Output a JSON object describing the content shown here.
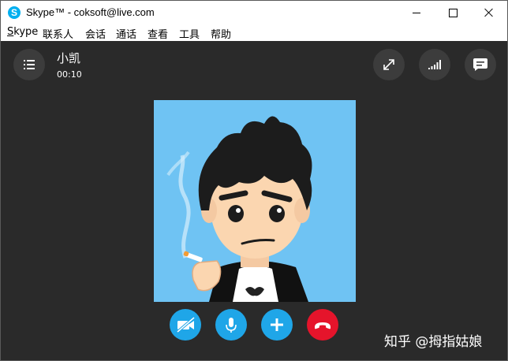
{
  "window": {
    "title": "Skype™ - coksoft@live.com",
    "logo_letter": "S"
  },
  "menu": {
    "items": [
      "Skype",
      "联系人",
      "会话",
      "通话",
      "查看",
      "工具",
      "帮助"
    ]
  },
  "call": {
    "contact_name": "小凯",
    "timer": "00:10"
  },
  "icons": {
    "menu": "list-menu-icon",
    "fullscreen": "expand-icon",
    "quality": "signal-bars-icon",
    "chat": "chat-bubble-icon",
    "video": "video-off-icon",
    "mic": "microphone-icon",
    "add": "plus-icon",
    "hangup": "end-call-icon"
  },
  "colors": {
    "call_background": "#2a2a2a",
    "control_blue": "#1fa6e8",
    "end_call_red": "#e5142b",
    "avatar_background": "#6fc3f3"
  },
  "watermark": "知乎 @拇指姑娘"
}
